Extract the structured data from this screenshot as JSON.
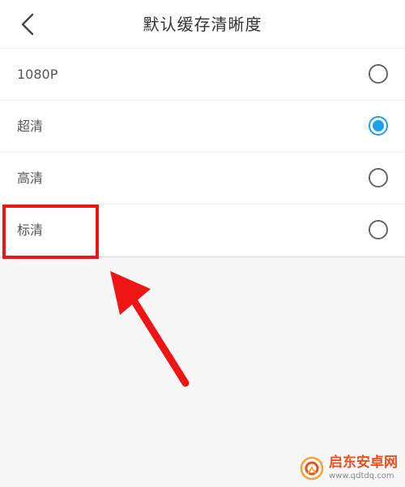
{
  "header": {
    "title": "默认缓存清晰度",
    "back_icon": "chevron-left-icon"
  },
  "options": [
    {
      "label": "1080P",
      "selected": false
    },
    {
      "label": "超清",
      "selected": true
    },
    {
      "label": "高清",
      "selected": false
    },
    {
      "label": "标清",
      "selected": false
    }
  ],
  "annotation": {
    "highlight_color": "#f01515",
    "highlighted_option": "标清"
  },
  "watermark": {
    "name": "启东安卓网",
    "url": "www.qdtdq.com"
  },
  "colors": {
    "accent": "#1aa1f0",
    "background": "#f7f7f7"
  }
}
